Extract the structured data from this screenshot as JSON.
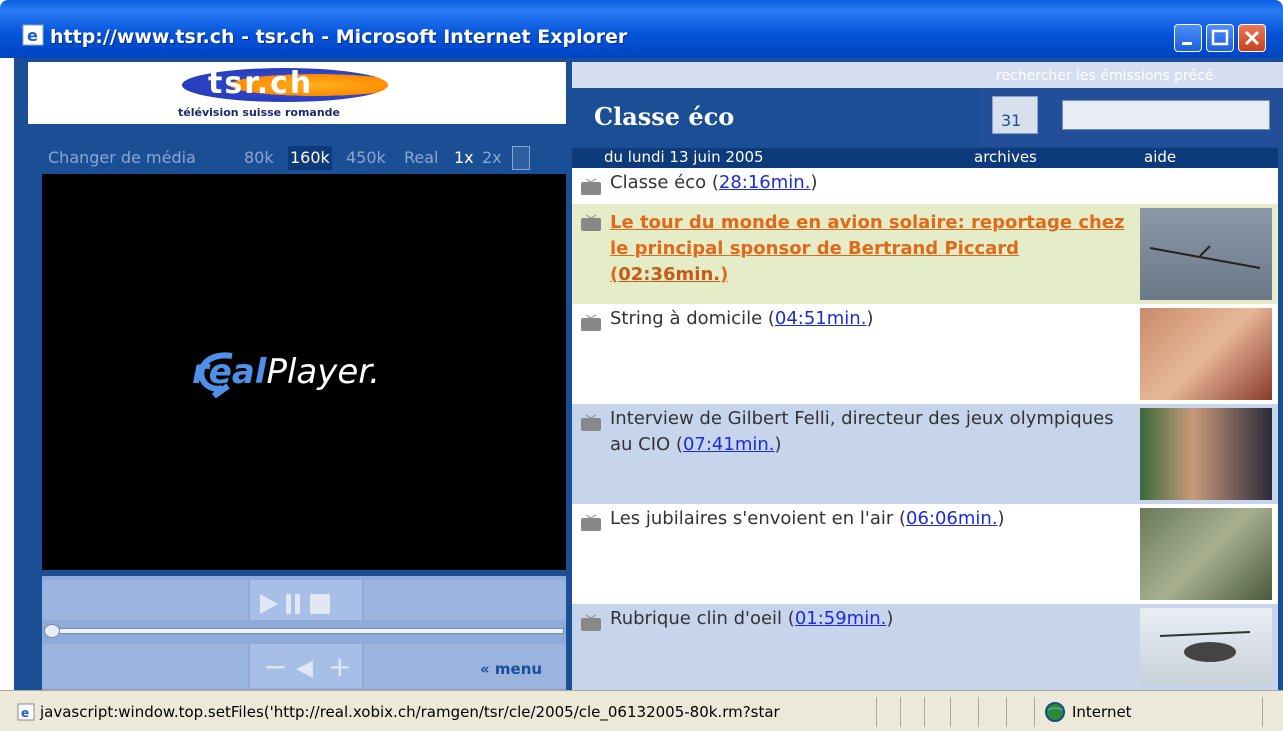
{
  "window": {
    "title": "http://www.tsr.ch - tsr.ch - Microsoft Internet Explorer"
  },
  "logo": {
    "text": "tsr.ch",
    "subtitle": "télévision suisse romande"
  },
  "media_bar": {
    "label": "Changer de média",
    "options": [
      "80k",
      "160k",
      "450k",
      "Real",
      "1x",
      "2x"
    ],
    "selected": "160k"
  },
  "player": {
    "brand_real": "real",
    "brand_player": "Player.",
    "menu_label": "« menu"
  },
  "right": {
    "search_hint": "rechercher les émissions précé",
    "show_title": "Classe éco",
    "calendar_label": "31",
    "search_value": "",
    "date_label": "du lundi 13 juin 2005",
    "archives_label": "archives",
    "aide_label": "aide",
    "items": [
      {
        "title": "Classe éco (",
        "duration": "28:16min.",
        "suffix": ")"
      },
      {
        "title": "Le tour du monde en avion solaire: reportage chez le principal sponsor de Bertrand Piccard (",
        "duration": "02:36min.",
        "suffix": ")"
      },
      {
        "title": "String à domicile (",
        "duration": "04:51min.",
        "suffix": ")"
      },
      {
        "title": "Interview de Gilbert Felli, directeur des jeux olympiques au CIO (",
        "duration": "07:41min.",
        "suffix": ")"
      },
      {
        "title": "Les jubilaires s'envoient en l'air (",
        "duration": "06:06min.",
        "suffix": ")"
      },
      {
        "title": "Rubrique clin d'oeil (",
        "duration": "01:59min.",
        "suffix": ")"
      }
    ]
  },
  "statusbar": {
    "text": "javascript:window.top.setFiles('http://real.xobix.ch/ramgen/tsr/cle/2005/cle_06132005-80k.rm?star",
    "zone": "Internet"
  },
  "colors": {
    "navy": "#1b4f95",
    "highlight_bg": "#e4edc8",
    "active_text": "#e3691a",
    "link": "#1b2bd8",
    "alt_row": "#c6d5ec"
  }
}
